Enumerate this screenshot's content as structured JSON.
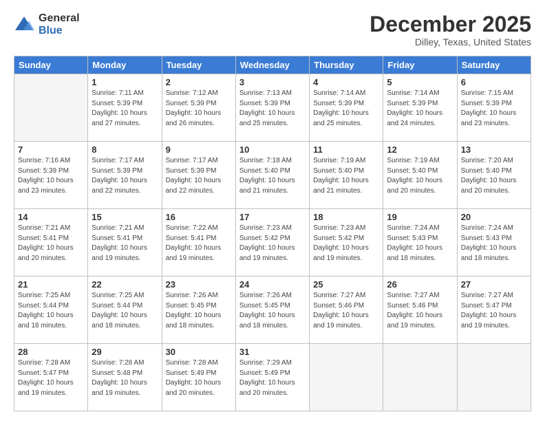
{
  "logo": {
    "general": "General",
    "blue": "Blue"
  },
  "header": {
    "month": "December 2025",
    "location": "Dilley, Texas, United States"
  },
  "weekdays": [
    "Sunday",
    "Monday",
    "Tuesday",
    "Wednesday",
    "Thursday",
    "Friday",
    "Saturday"
  ],
  "weeks": [
    [
      {
        "day": "",
        "info": ""
      },
      {
        "day": "1",
        "info": "Sunrise: 7:11 AM\nSunset: 5:39 PM\nDaylight: 10 hours\nand 27 minutes."
      },
      {
        "day": "2",
        "info": "Sunrise: 7:12 AM\nSunset: 5:39 PM\nDaylight: 10 hours\nand 26 minutes."
      },
      {
        "day": "3",
        "info": "Sunrise: 7:13 AM\nSunset: 5:39 PM\nDaylight: 10 hours\nand 25 minutes."
      },
      {
        "day": "4",
        "info": "Sunrise: 7:14 AM\nSunset: 5:39 PM\nDaylight: 10 hours\nand 25 minutes."
      },
      {
        "day": "5",
        "info": "Sunrise: 7:14 AM\nSunset: 5:39 PM\nDaylight: 10 hours\nand 24 minutes."
      },
      {
        "day": "6",
        "info": "Sunrise: 7:15 AM\nSunset: 5:39 PM\nDaylight: 10 hours\nand 23 minutes."
      }
    ],
    [
      {
        "day": "7",
        "info": "Sunrise: 7:16 AM\nSunset: 5:39 PM\nDaylight: 10 hours\nand 23 minutes."
      },
      {
        "day": "8",
        "info": "Sunrise: 7:17 AM\nSunset: 5:39 PM\nDaylight: 10 hours\nand 22 minutes."
      },
      {
        "day": "9",
        "info": "Sunrise: 7:17 AM\nSunset: 5:39 PM\nDaylight: 10 hours\nand 22 minutes."
      },
      {
        "day": "10",
        "info": "Sunrise: 7:18 AM\nSunset: 5:40 PM\nDaylight: 10 hours\nand 21 minutes."
      },
      {
        "day": "11",
        "info": "Sunrise: 7:19 AM\nSunset: 5:40 PM\nDaylight: 10 hours\nand 21 minutes."
      },
      {
        "day": "12",
        "info": "Sunrise: 7:19 AM\nSunset: 5:40 PM\nDaylight: 10 hours\nand 20 minutes."
      },
      {
        "day": "13",
        "info": "Sunrise: 7:20 AM\nSunset: 5:40 PM\nDaylight: 10 hours\nand 20 minutes."
      }
    ],
    [
      {
        "day": "14",
        "info": "Sunrise: 7:21 AM\nSunset: 5:41 PM\nDaylight: 10 hours\nand 20 minutes."
      },
      {
        "day": "15",
        "info": "Sunrise: 7:21 AM\nSunset: 5:41 PM\nDaylight: 10 hours\nand 19 minutes."
      },
      {
        "day": "16",
        "info": "Sunrise: 7:22 AM\nSunset: 5:41 PM\nDaylight: 10 hours\nand 19 minutes."
      },
      {
        "day": "17",
        "info": "Sunrise: 7:23 AM\nSunset: 5:42 PM\nDaylight: 10 hours\nand 19 minutes."
      },
      {
        "day": "18",
        "info": "Sunrise: 7:23 AM\nSunset: 5:42 PM\nDaylight: 10 hours\nand 19 minutes."
      },
      {
        "day": "19",
        "info": "Sunrise: 7:24 AM\nSunset: 5:43 PM\nDaylight: 10 hours\nand 18 minutes."
      },
      {
        "day": "20",
        "info": "Sunrise: 7:24 AM\nSunset: 5:43 PM\nDaylight: 10 hours\nand 18 minutes."
      }
    ],
    [
      {
        "day": "21",
        "info": "Sunrise: 7:25 AM\nSunset: 5:44 PM\nDaylight: 10 hours\nand 18 minutes."
      },
      {
        "day": "22",
        "info": "Sunrise: 7:25 AM\nSunset: 5:44 PM\nDaylight: 10 hours\nand 18 minutes."
      },
      {
        "day": "23",
        "info": "Sunrise: 7:26 AM\nSunset: 5:45 PM\nDaylight: 10 hours\nand 18 minutes."
      },
      {
        "day": "24",
        "info": "Sunrise: 7:26 AM\nSunset: 5:45 PM\nDaylight: 10 hours\nand 18 minutes."
      },
      {
        "day": "25",
        "info": "Sunrise: 7:27 AM\nSunset: 5:46 PM\nDaylight: 10 hours\nand 19 minutes."
      },
      {
        "day": "26",
        "info": "Sunrise: 7:27 AM\nSunset: 5:46 PM\nDaylight: 10 hours\nand 19 minutes."
      },
      {
        "day": "27",
        "info": "Sunrise: 7:27 AM\nSunset: 5:47 PM\nDaylight: 10 hours\nand 19 minutes."
      }
    ],
    [
      {
        "day": "28",
        "info": "Sunrise: 7:28 AM\nSunset: 5:47 PM\nDaylight: 10 hours\nand 19 minutes."
      },
      {
        "day": "29",
        "info": "Sunrise: 7:28 AM\nSunset: 5:48 PM\nDaylight: 10 hours\nand 19 minutes."
      },
      {
        "day": "30",
        "info": "Sunrise: 7:28 AM\nSunset: 5:49 PM\nDaylight: 10 hours\nand 20 minutes."
      },
      {
        "day": "31",
        "info": "Sunrise: 7:29 AM\nSunset: 5:49 PM\nDaylight: 10 hours\nand 20 minutes."
      },
      {
        "day": "",
        "info": ""
      },
      {
        "day": "",
        "info": ""
      },
      {
        "day": "",
        "info": ""
      }
    ]
  ]
}
